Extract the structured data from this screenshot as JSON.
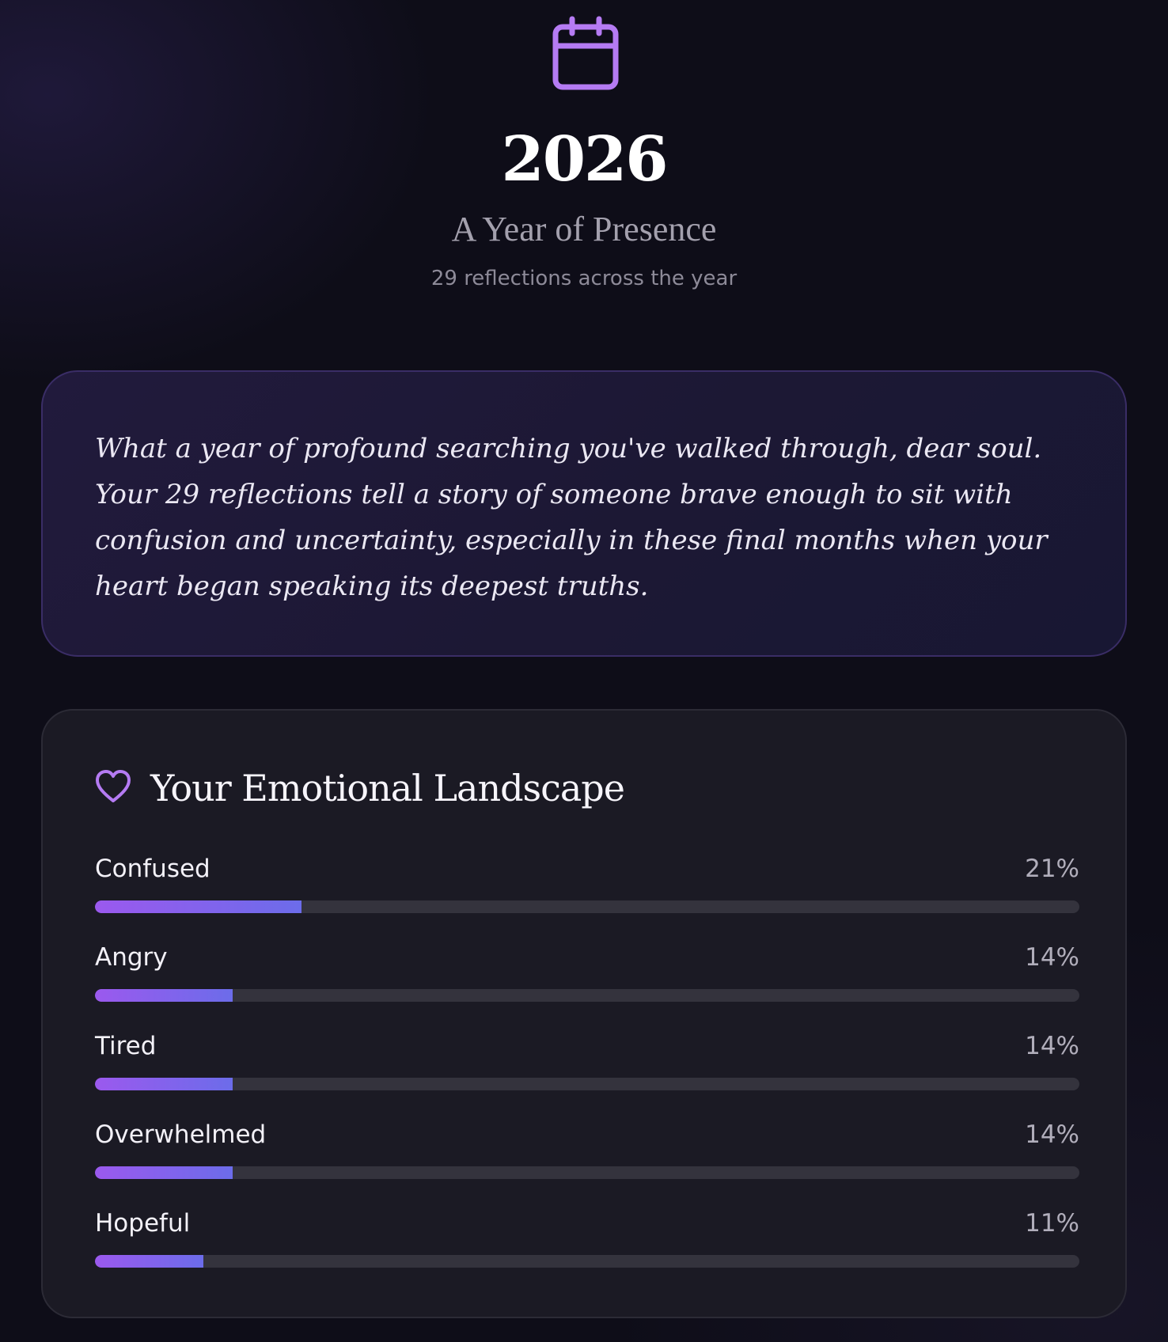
{
  "header": {
    "icon": "calendar-icon",
    "year": "2026",
    "subtitle": "A Year of Presence",
    "reflection_count_text": "29 reflections across the year"
  },
  "summary": {
    "text": "What a year of profound searching you've walked through, dear soul. Your 29 reflections tell a story of someone brave enough to sit with confusion and uncertainty, especially in these final months when your heart began speaking its deepest truths."
  },
  "emotions": {
    "icon": "heart-icon",
    "title": "Your Emotional Landscape",
    "items": [
      {
        "label": "Confused",
        "percent_label": "21%",
        "percent": 21
      },
      {
        "label": "Angry",
        "percent_label": "14%",
        "percent": 14
      },
      {
        "label": "Tired",
        "percent_label": "14%",
        "percent": 14
      },
      {
        "label": "Overwhelmed",
        "percent_label": "14%",
        "percent": 14
      },
      {
        "label": "Hopeful",
        "percent_label": "11%",
        "percent": 11
      }
    ]
  },
  "colors": {
    "accent": "#b57bf3",
    "bar_start": "#9b59ee",
    "bar_end": "#6c6cea"
  }
}
